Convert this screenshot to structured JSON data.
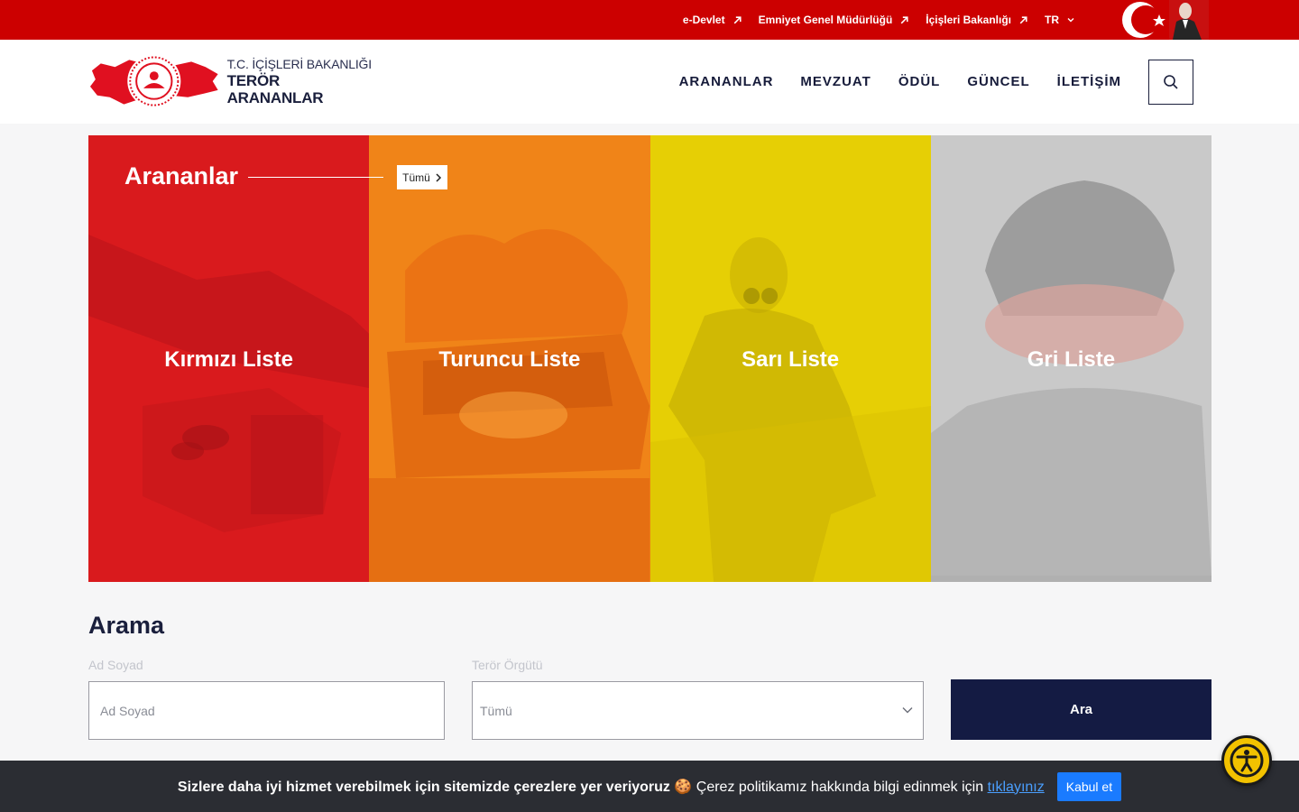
{
  "topbar": {
    "links": [
      {
        "label": "e-Devlet"
      },
      {
        "label": "Emniyet Genel Müdürlüğü"
      },
      {
        "label": "İçişleri Bakanlığı"
      }
    ],
    "language": "TR",
    "color": "#cc0000"
  },
  "header": {
    "logo_line1": "T.C. İÇİŞLERİ BAKANLIĞI",
    "logo_line2": "TERÖR ARANANLAR",
    "nav": [
      "ARANANLAR",
      "MEVZUAT",
      "ÖDÜL",
      "GÜNCEL",
      "İLETİŞİM"
    ],
    "search_icon": "search-icon"
  },
  "hero": {
    "title": "Arananlar",
    "all_button": "Tümü",
    "panels": [
      {
        "label": "Kırmızı Liste",
        "color": "#d91a1d"
      },
      {
        "label": "Turuncu Liste",
        "color": "#f08418"
      },
      {
        "label": "Sarı Liste",
        "color": "#e6cf05"
      },
      {
        "label": "Gri Liste",
        "color": "#c9c9c9"
      }
    ]
  },
  "search": {
    "title": "Arama",
    "name_label": "Ad Soyad",
    "name_placeholder": "Ad Soyad",
    "org_label": "Terör Örgütü",
    "org_selected": "Tümü",
    "submit": "Ara",
    "submit_color": "#141b43"
  },
  "cookie": {
    "bold_text": "Sizlere daha iyi hizmet verebilmek için sitemizde çerezlere yer veriyoruz",
    "emoji": "🍪",
    "text": "Çerez politikamız hakkında bilgi edinmek için",
    "link": "tıklayınız",
    "accept": "Kabul et"
  }
}
